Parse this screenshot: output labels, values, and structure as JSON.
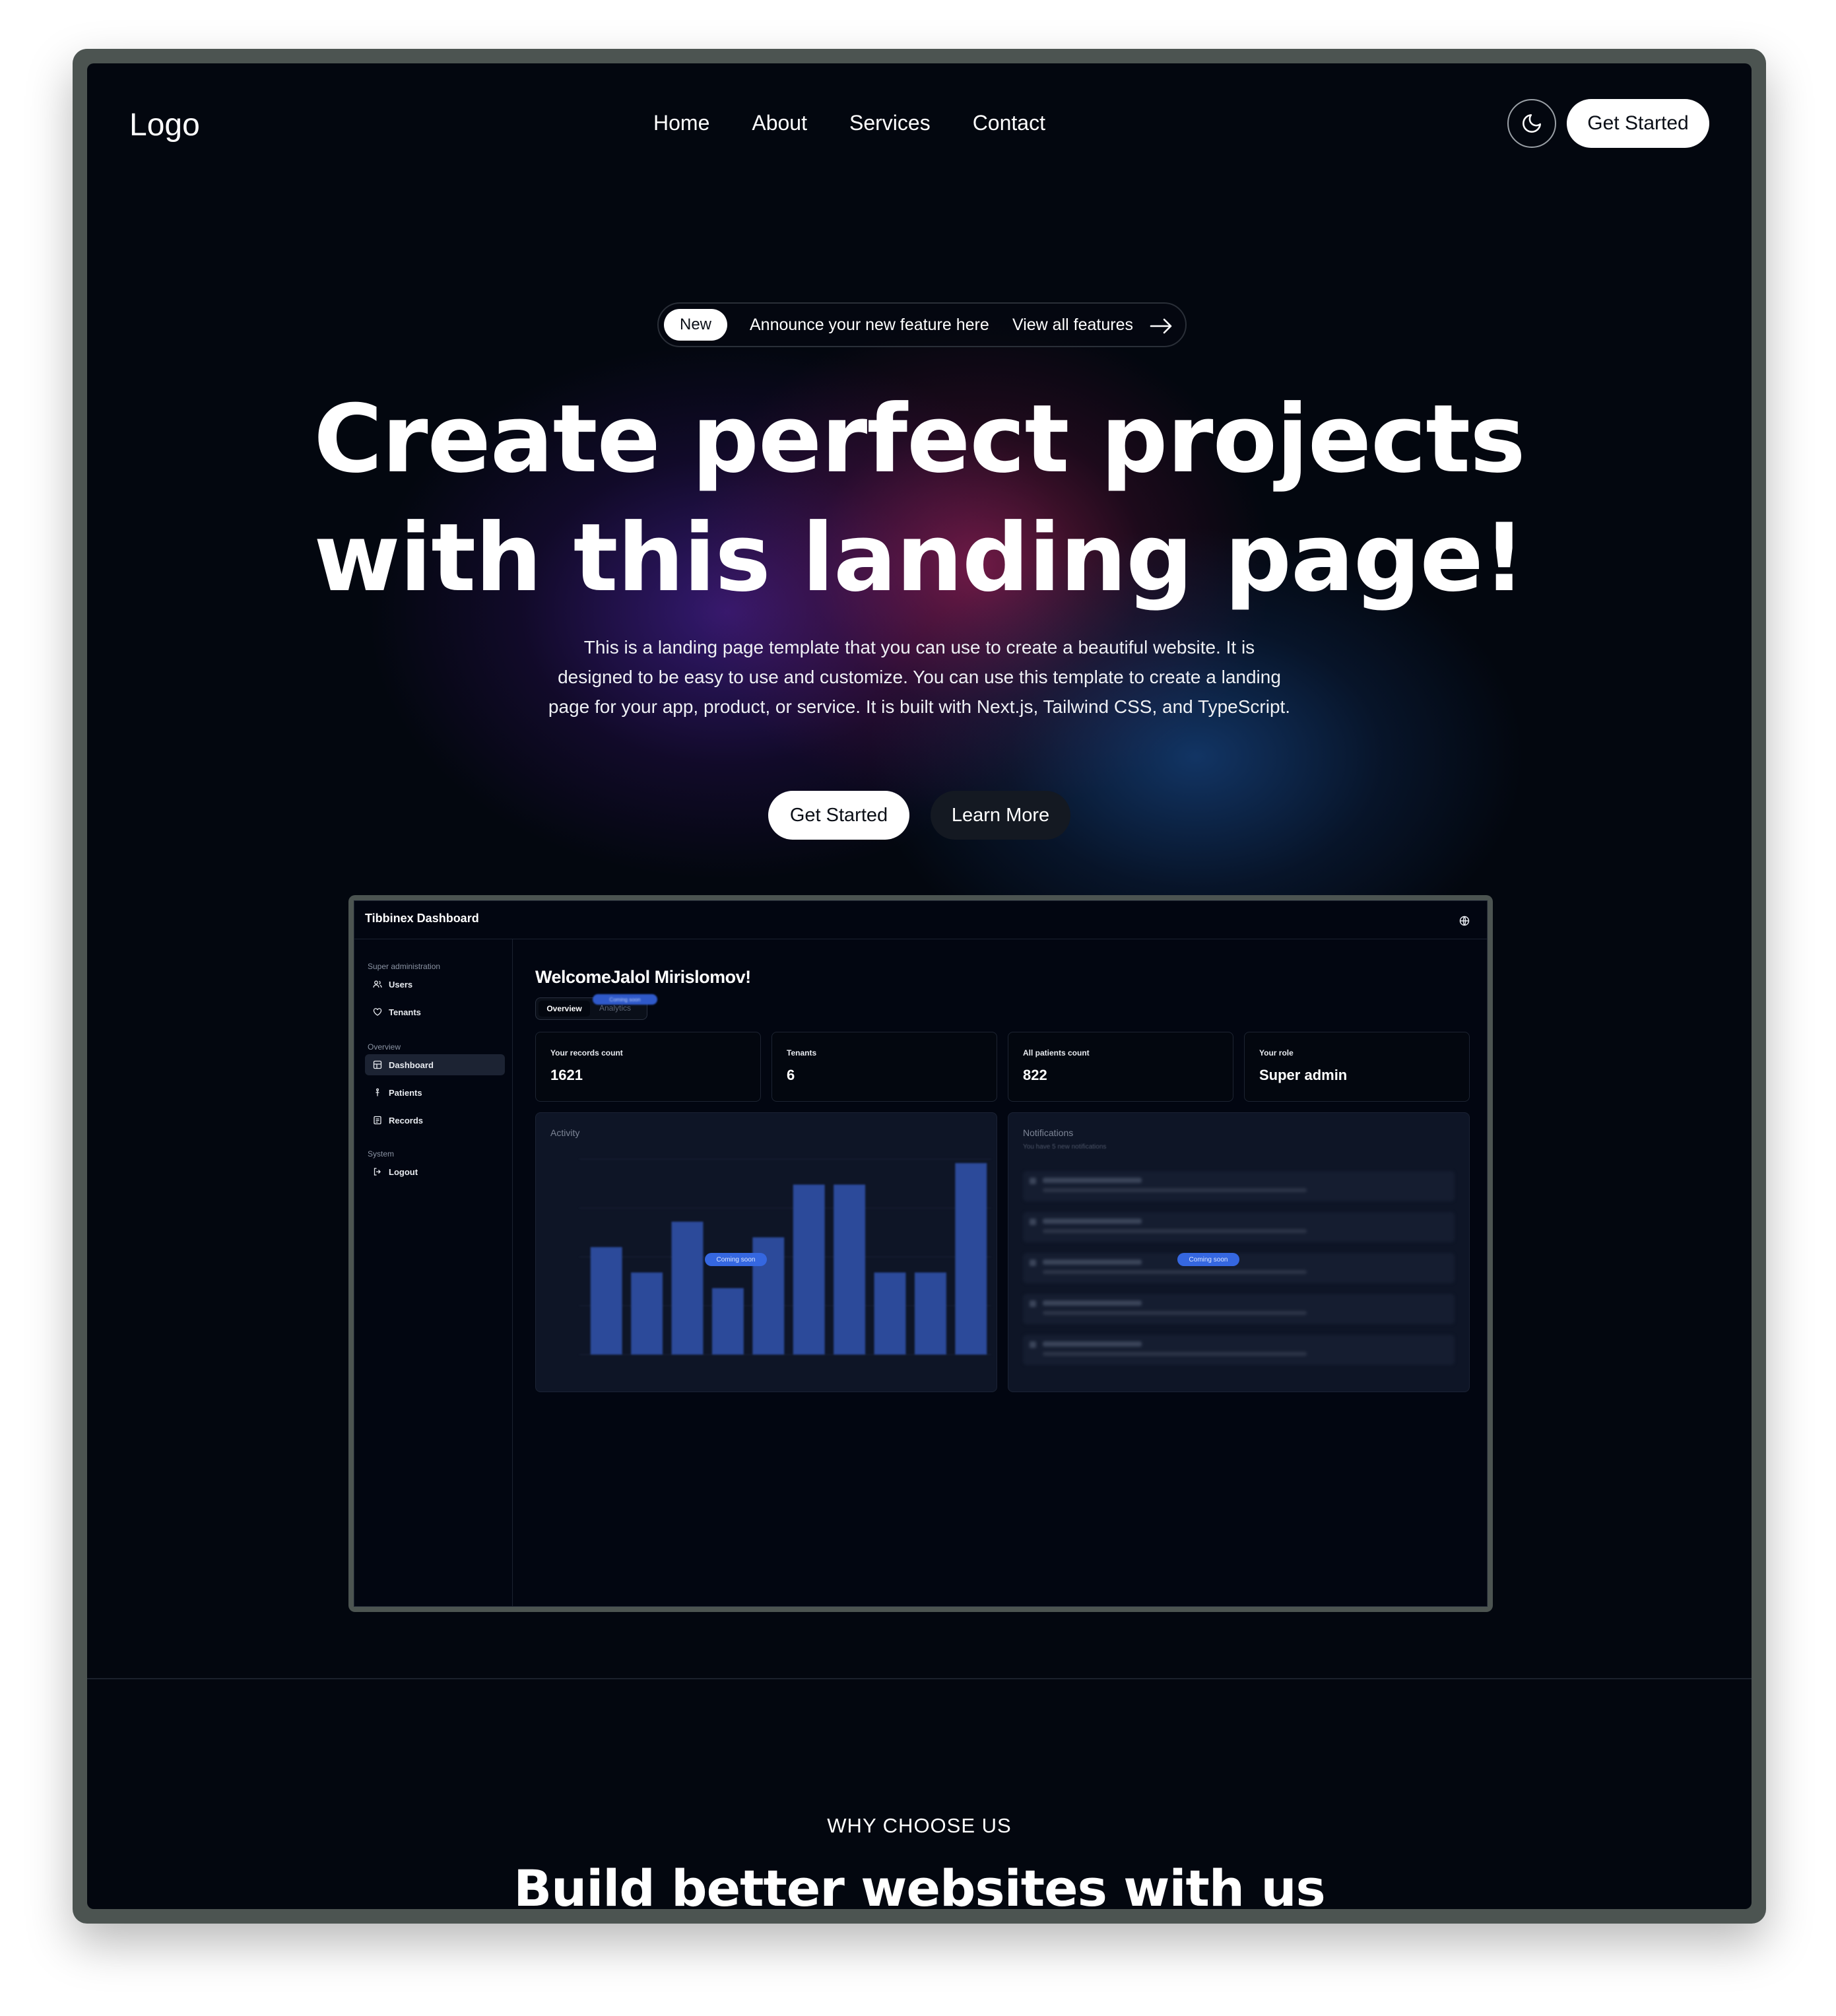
{
  "nav": {
    "logo": "Logo",
    "links": [
      "Home",
      "About",
      "Services",
      "Contact"
    ],
    "theme_icon": "moon-icon",
    "cta": "Get Started"
  },
  "announcement": {
    "badge": "New",
    "text": "Announce your new feature here",
    "link": "View all features",
    "link_icon": "arrow-right-icon"
  },
  "hero": {
    "title_line1": "Create perfect projects",
    "title_line2": "with this landing page!",
    "subtitle": "This is a landing page template that you can use to create a beautiful website. It is designed to be easy to use and customize. You can use this template to create a landing page for your app, product, or service. It is built with Next.js, Tailwind CSS, and TypeScript.",
    "primary_button": "Get Started",
    "secondary_button": "Learn More"
  },
  "dashboard": {
    "title": "Tibbinex Dashboard",
    "globe_icon": "globe-icon",
    "sidebar": {
      "groups": [
        {
          "label": "Super administration",
          "items": [
            {
              "label": "Users",
              "icon": "users-icon"
            },
            {
              "label": "Tenants",
              "icon": "heart-icon"
            }
          ]
        },
        {
          "label": "Overview",
          "items": [
            {
              "label": "Dashboard",
              "icon": "dashboard-icon",
              "active": true
            },
            {
              "label": "Patients",
              "icon": "person-icon"
            },
            {
              "label": "Records",
              "icon": "records-icon"
            }
          ]
        },
        {
          "label": "System",
          "items": [
            {
              "label": "Logout",
              "icon": "logout-icon"
            }
          ]
        }
      ]
    },
    "welcome": "WelcomeJalol Mirislomov!",
    "tabs": {
      "active": "Overview",
      "other": "Analytics",
      "soon_badge": "Coming soon"
    },
    "stats": [
      {
        "label": "Your records count",
        "value": "1621"
      },
      {
        "label": "Tenants",
        "value": "6"
      },
      {
        "label": "All patients count",
        "value": "822"
      },
      {
        "label": "Your role",
        "value": "Super admin"
      }
    ],
    "activity": {
      "title": "Activity",
      "badge": "Coming soon",
      "chart_data": {
        "type": "bar",
        "values": [
          55,
          42,
          68,
          34,
          60,
          87,
          87,
          42,
          42,
          98
        ],
        "ylim": [
          0,
          100
        ]
      }
    },
    "notifications": {
      "title": "Notifications",
      "subtitle": "You have 5 new notifications",
      "badge": "Coming soon",
      "items": [
        "Notification Title 1",
        "Notification Title 2",
        "Notification Title 3",
        "Notification Title 4",
        "Notification Title 5"
      ]
    }
  },
  "why": {
    "eyebrow": "WHY CHOOSE US",
    "title": "Build better websites with us"
  }
}
